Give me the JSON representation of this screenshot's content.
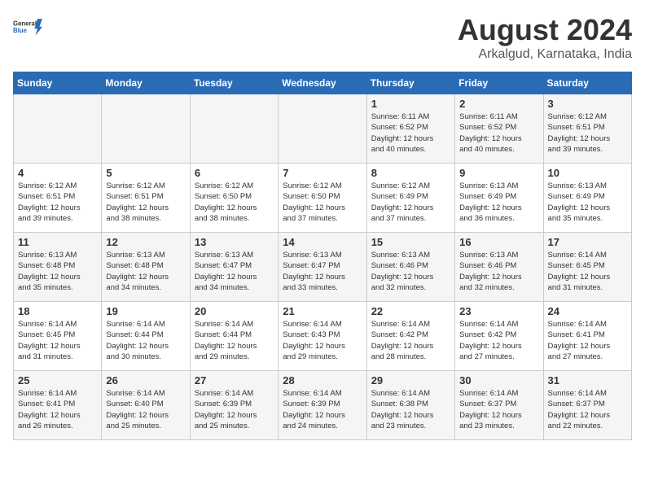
{
  "header": {
    "logo_general": "General",
    "logo_blue": "Blue",
    "month": "August 2024",
    "location": "Arkalgud, Karnataka, India"
  },
  "weekdays": [
    "Sunday",
    "Monday",
    "Tuesday",
    "Wednesday",
    "Thursday",
    "Friday",
    "Saturday"
  ],
  "weeks": [
    [
      {
        "day": "",
        "detail": ""
      },
      {
        "day": "",
        "detail": ""
      },
      {
        "day": "",
        "detail": ""
      },
      {
        "day": "",
        "detail": ""
      },
      {
        "day": "1",
        "detail": "Sunrise: 6:11 AM\nSunset: 6:52 PM\nDaylight: 12 hours\nand 40 minutes."
      },
      {
        "day": "2",
        "detail": "Sunrise: 6:11 AM\nSunset: 6:52 PM\nDaylight: 12 hours\nand 40 minutes."
      },
      {
        "day": "3",
        "detail": "Sunrise: 6:12 AM\nSunset: 6:51 PM\nDaylight: 12 hours\nand 39 minutes."
      }
    ],
    [
      {
        "day": "4",
        "detail": "Sunrise: 6:12 AM\nSunset: 6:51 PM\nDaylight: 12 hours\nand 39 minutes."
      },
      {
        "day": "5",
        "detail": "Sunrise: 6:12 AM\nSunset: 6:51 PM\nDaylight: 12 hours\nand 38 minutes."
      },
      {
        "day": "6",
        "detail": "Sunrise: 6:12 AM\nSunset: 6:50 PM\nDaylight: 12 hours\nand 38 minutes."
      },
      {
        "day": "7",
        "detail": "Sunrise: 6:12 AM\nSunset: 6:50 PM\nDaylight: 12 hours\nand 37 minutes."
      },
      {
        "day": "8",
        "detail": "Sunrise: 6:12 AM\nSunset: 6:49 PM\nDaylight: 12 hours\nand 37 minutes."
      },
      {
        "day": "9",
        "detail": "Sunrise: 6:13 AM\nSunset: 6:49 PM\nDaylight: 12 hours\nand 36 minutes."
      },
      {
        "day": "10",
        "detail": "Sunrise: 6:13 AM\nSunset: 6:49 PM\nDaylight: 12 hours\nand 35 minutes."
      }
    ],
    [
      {
        "day": "11",
        "detail": "Sunrise: 6:13 AM\nSunset: 6:48 PM\nDaylight: 12 hours\nand 35 minutes."
      },
      {
        "day": "12",
        "detail": "Sunrise: 6:13 AM\nSunset: 6:48 PM\nDaylight: 12 hours\nand 34 minutes."
      },
      {
        "day": "13",
        "detail": "Sunrise: 6:13 AM\nSunset: 6:47 PM\nDaylight: 12 hours\nand 34 minutes."
      },
      {
        "day": "14",
        "detail": "Sunrise: 6:13 AM\nSunset: 6:47 PM\nDaylight: 12 hours\nand 33 minutes."
      },
      {
        "day": "15",
        "detail": "Sunrise: 6:13 AM\nSunset: 6:46 PM\nDaylight: 12 hours\nand 32 minutes."
      },
      {
        "day": "16",
        "detail": "Sunrise: 6:13 AM\nSunset: 6:46 PM\nDaylight: 12 hours\nand 32 minutes."
      },
      {
        "day": "17",
        "detail": "Sunrise: 6:14 AM\nSunset: 6:45 PM\nDaylight: 12 hours\nand 31 minutes."
      }
    ],
    [
      {
        "day": "18",
        "detail": "Sunrise: 6:14 AM\nSunset: 6:45 PM\nDaylight: 12 hours\nand 31 minutes."
      },
      {
        "day": "19",
        "detail": "Sunrise: 6:14 AM\nSunset: 6:44 PM\nDaylight: 12 hours\nand 30 minutes."
      },
      {
        "day": "20",
        "detail": "Sunrise: 6:14 AM\nSunset: 6:44 PM\nDaylight: 12 hours\nand 29 minutes."
      },
      {
        "day": "21",
        "detail": "Sunrise: 6:14 AM\nSunset: 6:43 PM\nDaylight: 12 hours\nand 29 minutes."
      },
      {
        "day": "22",
        "detail": "Sunrise: 6:14 AM\nSunset: 6:42 PM\nDaylight: 12 hours\nand 28 minutes."
      },
      {
        "day": "23",
        "detail": "Sunrise: 6:14 AM\nSunset: 6:42 PM\nDaylight: 12 hours\nand 27 minutes."
      },
      {
        "day": "24",
        "detail": "Sunrise: 6:14 AM\nSunset: 6:41 PM\nDaylight: 12 hours\nand 27 minutes."
      }
    ],
    [
      {
        "day": "25",
        "detail": "Sunrise: 6:14 AM\nSunset: 6:41 PM\nDaylight: 12 hours\nand 26 minutes."
      },
      {
        "day": "26",
        "detail": "Sunrise: 6:14 AM\nSunset: 6:40 PM\nDaylight: 12 hours\nand 25 minutes."
      },
      {
        "day": "27",
        "detail": "Sunrise: 6:14 AM\nSunset: 6:39 PM\nDaylight: 12 hours\nand 25 minutes."
      },
      {
        "day": "28",
        "detail": "Sunrise: 6:14 AM\nSunset: 6:39 PM\nDaylight: 12 hours\nand 24 minutes."
      },
      {
        "day": "29",
        "detail": "Sunrise: 6:14 AM\nSunset: 6:38 PM\nDaylight: 12 hours\nand 23 minutes."
      },
      {
        "day": "30",
        "detail": "Sunrise: 6:14 AM\nSunset: 6:37 PM\nDaylight: 12 hours\nand 23 minutes."
      },
      {
        "day": "31",
        "detail": "Sunrise: 6:14 AM\nSunset: 6:37 PM\nDaylight: 12 hours\nand 22 minutes."
      }
    ]
  ]
}
